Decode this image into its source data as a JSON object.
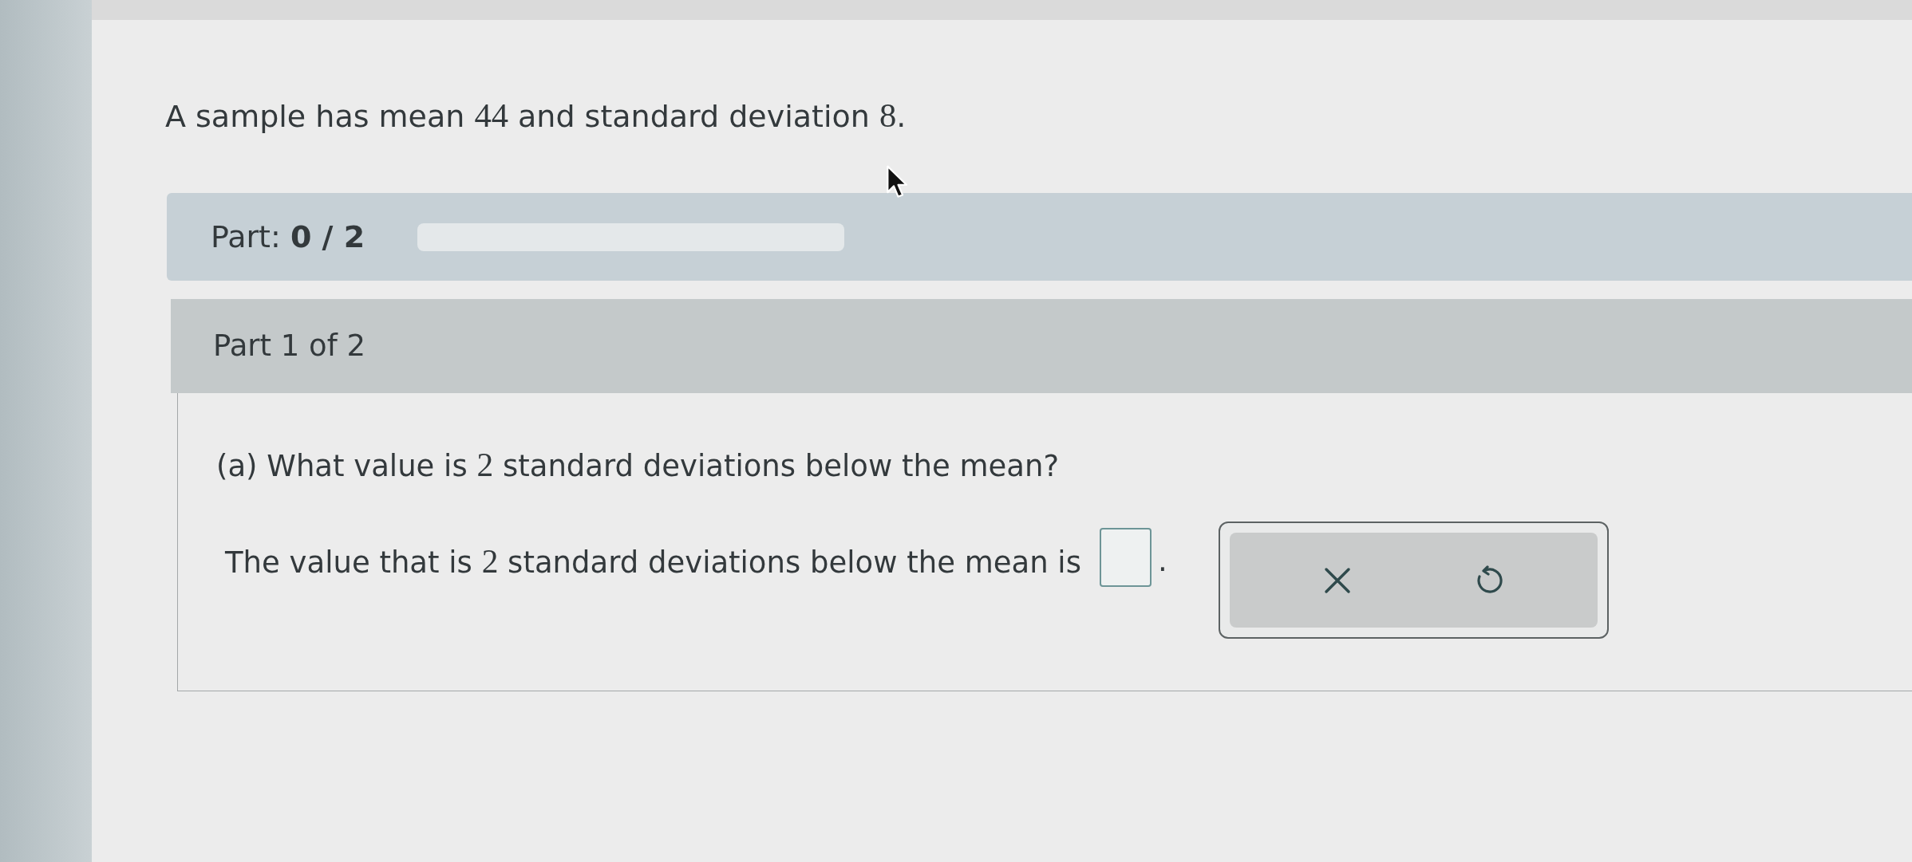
{
  "problem": {
    "segments": [
      {
        "kind": "text",
        "text": "A sample has mean "
      },
      {
        "kind": "math",
        "text": "44"
      },
      {
        "kind": "text",
        "text": " and standard deviation "
      },
      {
        "kind": "math",
        "text": "8"
      },
      {
        "kind": "text",
        "text": "."
      }
    ]
  },
  "progress": {
    "label": "Part:",
    "count": "0 / 2"
  },
  "part": {
    "title": "Part 1 of 2",
    "question": {
      "segments": [
        {
          "kind": "text",
          "text": "(a) What value is "
        },
        {
          "kind": "math",
          "text": "2"
        },
        {
          "kind": "text",
          "text": " standard deviations below the mean?"
        }
      ]
    },
    "answer": {
      "segments": [
        {
          "kind": "text",
          "text": "The value that is "
        },
        {
          "kind": "math",
          "text": "2"
        },
        {
          "kind": "text",
          "text": " standard deviations below the mean is"
        }
      ],
      "suffix": "."
    }
  }
}
